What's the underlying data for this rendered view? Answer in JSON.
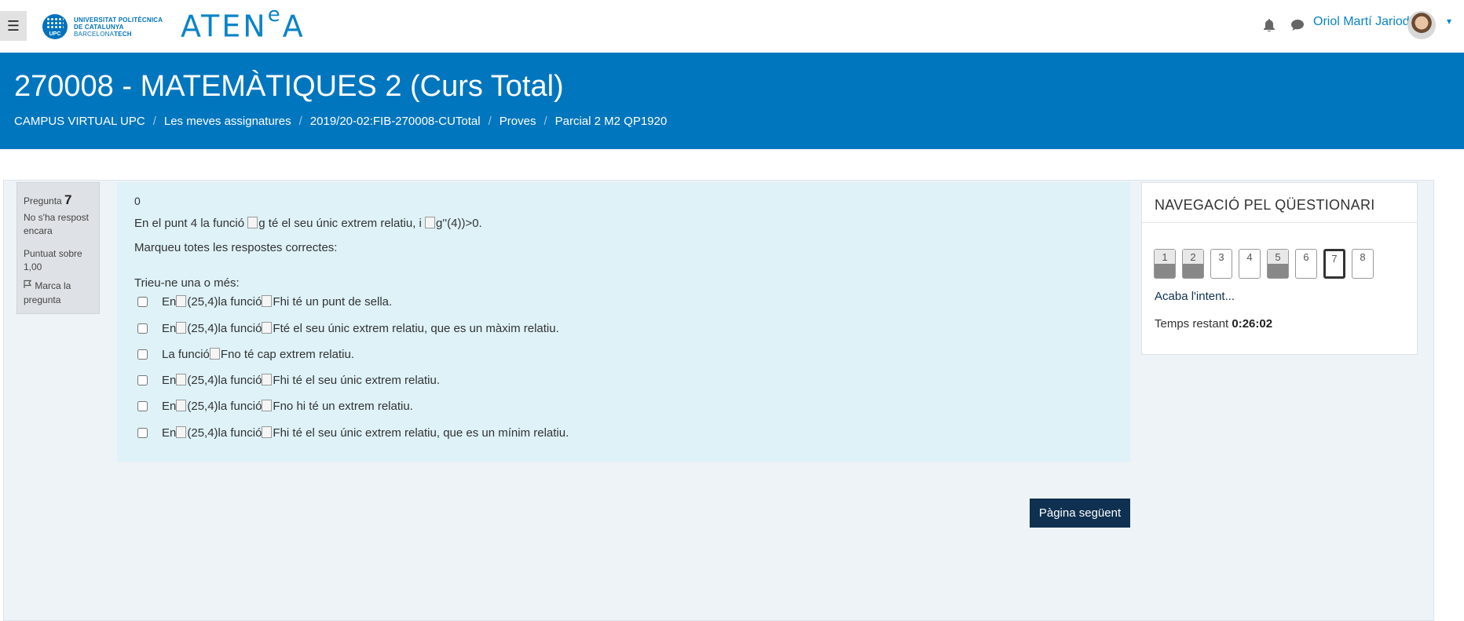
{
  "navbar": {
    "menu_icon": "hamburger-icon",
    "upc": {
      "seal_text": "UPC",
      "line1": "UNIVERSITAT POLITÈCNICA",
      "line2": "DE CATALUNYA",
      "line3a": "BARCELONA",
      "line3b": "TECH"
    },
    "atenea": {
      "part1": "ATEN",
      "sup": "e",
      "part2": "A"
    },
    "bell_icon": "bell-icon",
    "chat_icon": "chat-icon",
    "user_name": "Oriol Martí Jariod",
    "caret": "▾"
  },
  "header": {
    "title": "270008 - MATEMÀTIQUES 2 (Curs Total)",
    "breadcrumb": [
      "CAMPUS VIRTUAL UPC",
      "Les meves assignatures",
      "2019/20-02:FIB-270008-CUTotal",
      "Proves",
      "Parcial 2 M2 QP1920"
    ],
    "separator": "/"
  },
  "question_info": {
    "label": "Pregunta",
    "number": "7",
    "status": "No s'ha respost encara",
    "marks": "Puntuat sobre 1,00",
    "flag_label": "Marca la pregunta"
  },
  "question": {
    "grade": "0",
    "text_pre": "En el punt 4 la funció ",
    "img_g": "g",
    "text_mid": " té el seu únic extrem relatiu, i ",
    "img_g2": "g''(4))>0",
    "text_end": ".",
    "instruction": "Marqueu totes les respostes correctes:",
    "prompt": "Trieu-ne una o més:",
    "answers": [
      {
        "pre": "En ",
        "point": "(25,4)",
        "mid": " la funció ",
        "func": "F",
        "post": " hi té un punt de sella."
      },
      {
        "pre": "En ",
        "point": "(25,4)",
        "mid": " la funció ",
        "func": "F",
        "post": " té el seu únic extrem relatiu, que es un màxim relatiu."
      },
      {
        "pre": "La funció ",
        "func": "F",
        "post": " no té cap extrem relatiu."
      },
      {
        "pre": "En ",
        "point": "(25,4)",
        "mid": " la funció ",
        "func": "F",
        "post": " hi té el seu únic extrem relatiu."
      },
      {
        "pre": "En ",
        "point": "(25,4)",
        "mid": " la funció ",
        "func": "F",
        "post": " no hi té un extrem relatiu."
      },
      {
        "pre": "En ",
        "point": "(25,4)",
        "mid": " la funció ",
        "func": "F",
        "post": " hi té el seu únic extrem relatiu, que es un mínim relatiu."
      }
    ],
    "next_button": "Pàgina següent"
  },
  "quiz_nav": {
    "title": "NAVEGACIÓ PEL QÜESTIONARI",
    "buttons": [
      {
        "label": "1",
        "state": "answered"
      },
      {
        "label": "2",
        "state": "answered"
      },
      {
        "label": "3",
        "state": "unanswered"
      },
      {
        "label": "4",
        "state": "unanswered"
      },
      {
        "label": "5",
        "state": "answered"
      },
      {
        "label": "6",
        "state": "unanswered"
      },
      {
        "label": "7",
        "state": "current"
      },
      {
        "label": "8",
        "state": "unanswered"
      }
    ],
    "finish_link": "Acaba l'intent...",
    "timer_label": "Temps restant ",
    "timer_value": "0:26:02"
  },
  "colors": {
    "brand_blue": "#0076be",
    "question_bg": "#def2f8",
    "next_button_bg": "#0f3050"
  }
}
